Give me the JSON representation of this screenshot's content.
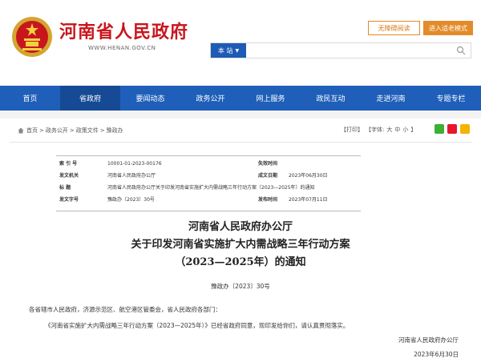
{
  "header": {
    "site_name": "河南省人民政府",
    "site_url": "WWW.HENAN.GOV.CN",
    "accessibility_btn": "无障碍阅读",
    "elder_btn": "进入适老模式",
    "search_scope": "本 站",
    "search_placeholder": ""
  },
  "nav": {
    "items": [
      "首页",
      "省政府",
      "要闻动态",
      "政务公开",
      "网上服务",
      "政民互动",
      "走进河南",
      "专题专栏"
    ],
    "active_index": 1
  },
  "breadcrumb": {
    "items": [
      "首页",
      "政务公开",
      "政策文件",
      "豫政办"
    ]
  },
  "tools": {
    "print": "【打印】",
    "font_label": "【字体:",
    "font_large": "大",
    "font_medium": "中",
    "font_small": "小",
    "font_close": "】"
  },
  "meta": {
    "index_label": "索 引 号",
    "index_value": "10001-01-2023-00176",
    "validity_label": "失效时间",
    "validity_value": "",
    "issuer_label": "发文机关",
    "issuer_value": "河南省人民政府办公厅",
    "created_label": "成文日期",
    "created_value": "2023年06月30日",
    "title_label": "标    题",
    "title_value": "河南省人民政府办公厅关于印发河南省实施扩大内需战略三年行动方案（2023—2025年）的通知",
    "docno_label": "发文字号",
    "docno_value": "豫政办〔2023〕30号",
    "published_label": "发布时间",
    "published_value": "2023年07月11日"
  },
  "document": {
    "title_line1": "河南省人民政府办公厅",
    "title_line2": "关于印发河南省实施扩大内需战略三年行动方案",
    "title_line3": "（2023—2025年）的通知",
    "doc_number": "豫政办〔2023〕30号",
    "para1": "各省辖市人民政府，济源示范区、航空港区管委会，省人民政府各部门：",
    "para2": "《河南省实施扩大内需战略三年行动方案（2023—2025年）》已经省政府同意，现印发给你们，请认真贯彻落实。",
    "signature": "河南省人民政府办公厅",
    "date": "2023年6月30日"
  },
  "colors": {
    "brand_red": "#c8161d",
    "nav_blue": "#1f5fb9",
    "accent_orange": "#e38b28"
  }
}
